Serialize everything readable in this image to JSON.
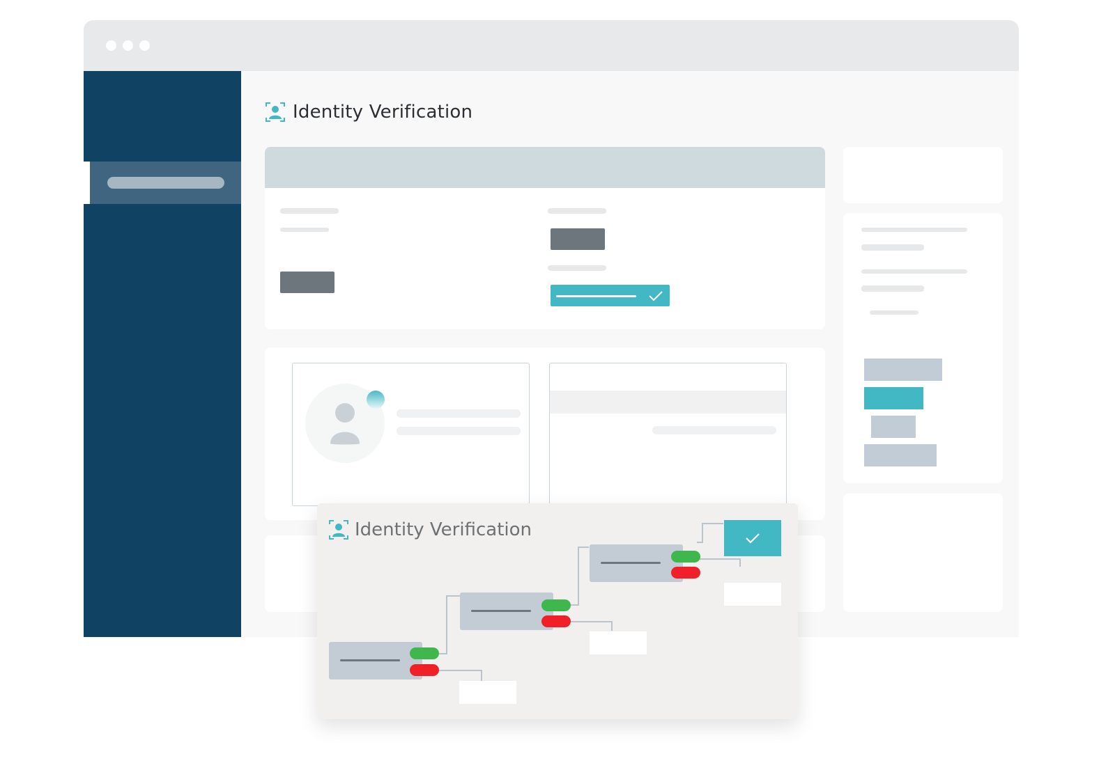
{
  "page": {
    "title": "Identity Verification"
  },
  "overlay": {
    "title": "Identity Verification"
  },
  "icons": {
    "window_controls": "window-dot",
    "title_icon": "identity-icon",
    "check": "checkmark-icon",
    "avatar": "user-avatar-icon"
  },
  "colors": {
    "sidebar": "#0f4263",
    "accent_teal": "#41b8c3",
    "pass_green": "#3fb74e",
    "fail_red": "#ef2027",
    "node_slate": "#c3ccd5"
  }
}
